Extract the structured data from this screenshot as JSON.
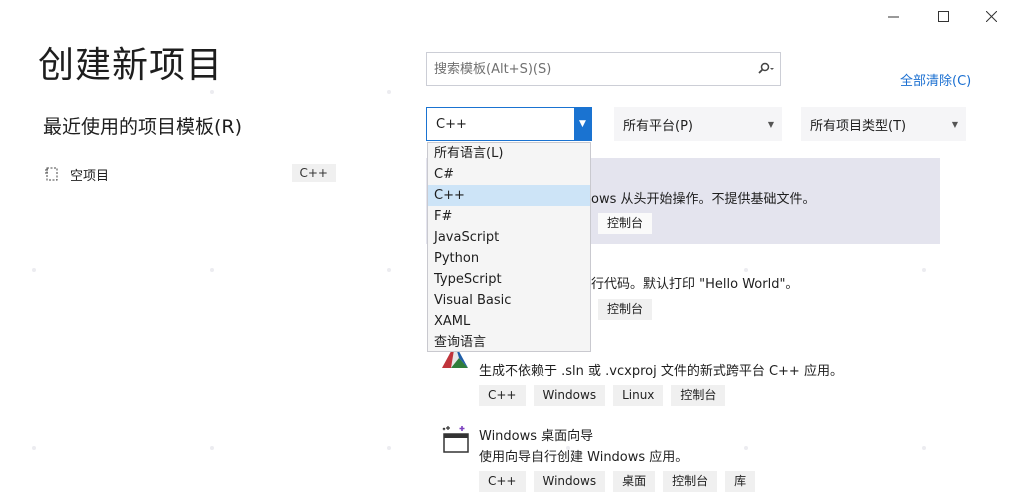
{
  "window": {
    "min": "—",
    "max": "☐",
    "close": "✕"
  },
  "page_title": "创建新项目",
  "recent_section_title": "最近使用的项目模板(R)",
  "recent_items": [
    {
      "label": "空项目",
      "tag": "C++"
    }
  ],
  "search": {
    "placeholder": "搜索模板(Alt+S)(S)",
    "value": ""
  },
  "clear_all": "全部清除(C)",
  "filters": {
    "language": "C++",
    "platform": "所有平台(P)",
    "project_type": "所有项目类型(T)"
  },
  "language_options": [
    "所有语言(L)",
    "C#",
    "C++",
    "F#",
    "JavaScript",
    "Python",
    "TypeScript",
    "Visual Basic",
    "XAML",
    "查询语言"
  ],
  "selected_language_index": 2,
  "templates": [
    {
      "desc": "ows 从头开始操作。不提供基础文件。",
      "tags": [
        "控制台"
      ]
    },
    {
      "desc": "行代码。默认打印 \"Hello World\"。",
      "tags": [
        "控制台"
      ]
    },
    {
      "desc": "生成不依赖于 .sln 或 .vcxproj 文件的新式跨平台 C++ 应用。",
      "tags": [
        "C++",
        "Windows",
        "Linux",
        "控制台"
      ]
    },
    {
      "title": "Windows 桌面向导",
      "desc": "使用向导自行创建 Windows 应用。",
      "tags": [
        "C++",
        "Windows",
        "桌面",
        "控制台",
        "库"
      ]
    }
  ],
  "colors": {
    "accent": "#1a73d1",
    "selected_bg": "#e4e4ee",
    "link": "#1a6fd1"
  }
}
